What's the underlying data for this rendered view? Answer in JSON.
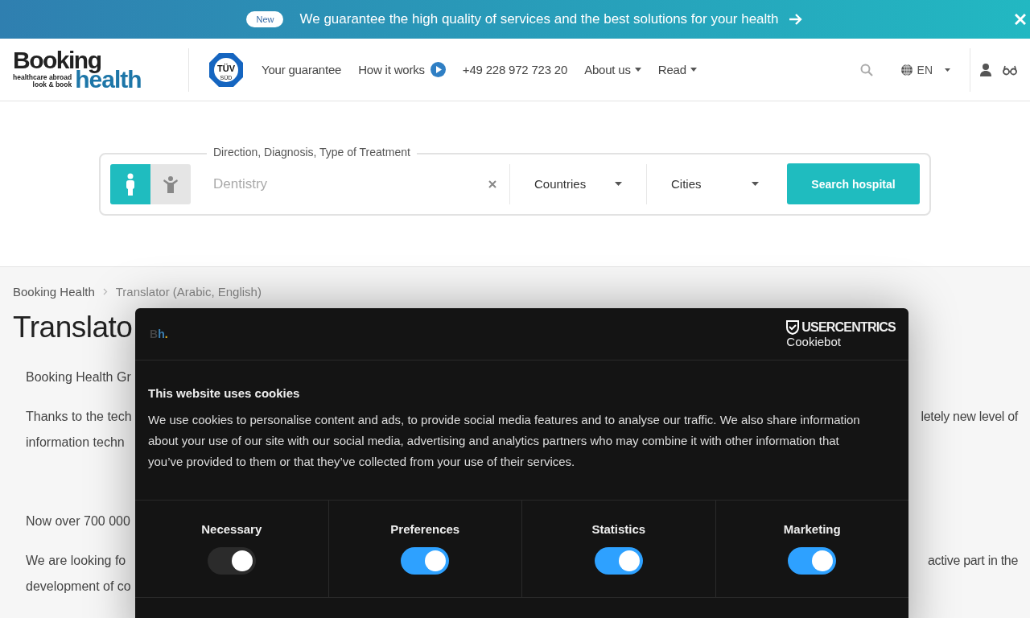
{
  "banner": {
    "badge": "New",
    "text": "We guarantee the high quality of services and the best solutions for your health"
  },
  "header": {
    "logo": {
      "word1": "Booking",
      "tagline1": "healthcare abroad",
      "tagline2": "look & book",
      "word2": "health"
    },
    "tuv_badge": {
      "top": "TÜV",
      "bottom": "SÜD"
    },
    "nav": [
      {
        "label": "Your guarantee",
        "kind": "link"
      },
      {
        "label": "How it works",
        "kind": "play"
      },
      {
        "label": "+49 228 972 723 20",
        "kind": "link"
      },
      {
        "label": "About us",
        "kind": "dropdown"
      },
      {
        "label": "Read",
        "kind": "dropdown"
      }
    ],
    "language": "EN"
  },
  "search": {
    "legend": "Direction, Diagnosis, Type of Treatment",
    "patient_types": [
      {
        "kind": "adult",
        "selected": true
      },
      {
        "kind": "child",
        "selected": false
      }
    ],
    "placeholder": "Dentistry",
    "countries": "Countries",
    "cities": "Cities",
    "button": "Search hospital"
  },
  "breadcrumb": [
    "Booking Health",
    "Translator (Arabic, English)"
  ],
  "title": "Translato",
  "paragraphs": [
    [
      {
        "left": "Booking Health Gr"
      }
    ],
    [
      {
        "left": "Thanks to the tech",
        "right": "letely new level of"
      },
      {
        "left": "information techn"
      }
    ],
    [
      {
        "left": "Now over 700 000"
      }
    ],
    [
      {
        "left": "We are looking fo",
        "right": "active part in the"
      },
      {
        "left": "development of co"
      }
    ]
  ],
  "cookie_dialog": {
    "logo": "Bh.",
    "brand": "USERCENTRICS",
    "product": "Cookiebot",
    "title": "This website uses cookies",
    "text": "We use cookies to personalise content and ads, to provide social media features and to analyse our traffic. We also share information about your use of our site with our social media, advertising and analytics partners who may combine it with other information that you’ve provided to them or that they’ve collected from your use of their services.",
    "toggles": [
      {
        "label": "Necessary",
        "on": true,
        "disabled": true
      },
      {
        "label": "Preferences",
        "on": true,
        "disabled": false
      },
      {
        "label": "Statistics",
        "on": true,
        "disabled": false
      },
      {
        "label": "Marketing",
        "on": true,
        "disabled": false
      }
    ]
  }
}
